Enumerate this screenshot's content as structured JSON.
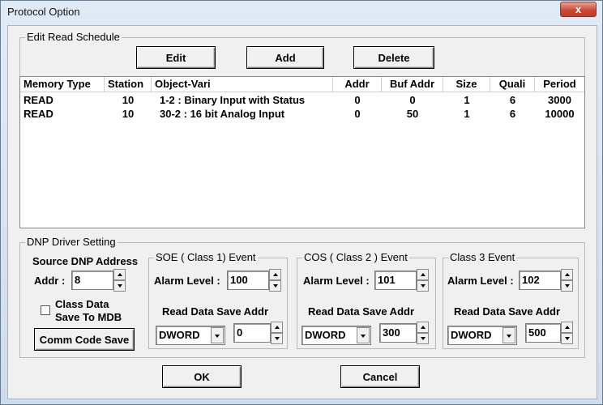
{
  "window": {
    "title": "Protocol Option",
    "close_glyph": "x"
  },
  "schedule": {
    "legend": "Edit Read Schedule",
    "buttons": {
      "edit": "Edit",
      "add": "Add",
      "delete": "Delete"
    },
    "columns": [
      "Memory Type",
      "Station",
      "Object-Vari",
      "Addr",
      "Buf Addr",
      "Size",
      "Quali",
      "Period"
    ],
    "rows": [
      [
        "READ",
        "10",
        "1-2 : Binary Input with Status",
        "0",
        "0",
        "1",
        "6",
        "3000"
      ],
      [
        "READ",
        "10",
        "30-2 : 16 bit Analog Input",
        "0",
        "50",
        "1",
        "6",
        "10000"
      ]
    ]
  },
  "dnp": {
    "legend": "DNP Driver Setting",
    "source_addr_title": "Source DNP Address",
    "addr_label": "Addr :",
    "addr_value": "8",
    "class_data_label_1": "Class Data",
    "class_data_label_2": "Save To MDB",
    "class_data_checked": false,
    "comm_code_save": "Comm Code Save",
    "events": [
      {
        "legend": "SOE ( Class 1) Event",
        "alarm_label": "Alarm Level :",
        "alarm_value": "100",
        "save_addr_label": "Read Data Save Addr",
        "type": "DWORD",
        "addr": "0"
      },
      {
        "legend": "COS ( Class 2 )  Event",
        "alarm_label": "Alarm Level :",
        "alarm_value": "101",
        "save_addr_label": "Read Data Save Addr",
        "type": "DWORD",
        "addr": "300"
      },
      {
        "legend": "Class 3  Event",
        "alarm_label": "Alarm Level :",
        "alarm_value": "102",
        "save_addr_label": "Read Data Save Addr",
        "type": "DWORD",
        "addr": "500"
      }
    ]
  },
  "footer": {
    "ok": "OK",
    "cancel": "Cancel"
  }
}
